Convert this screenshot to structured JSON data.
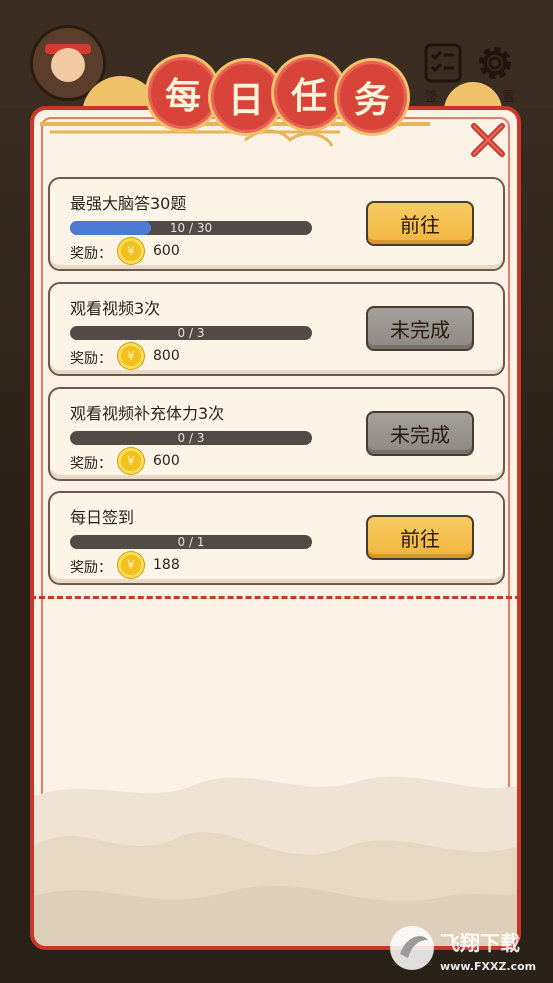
{
  "title_chars": [
    "每",
    "日",
    "任",
    "务"
  ],
  "top_right": {
    "checkin_label": "签",
    "settings_label": "置"
  },
  "tasks": [
    {
      "name": "最强大脑答30题",
      "progress_text": "10 / 30",
      "progress": 0.3333,
      "reward_label": "奖励：",
      "coin_symbol": "¥",
      "reward": "600",
      "button": "前往",
      "state": "go"
    },
    {
      "name": "观看视频3次",
      "progress_text": "0 / 3",
      "progress": 0,
      "reward_label": "奖励：",
      "coin_symbol": "¥",
      "reward": "800",
      "button": "未完成",
      "state": "pending"
    },
    {
      "name": "观看视频补充体力3次",
      "progress_text": "0 / 3",
      "progress": 0,
      "reward_label": "奖励：",
      "coin_symbol": "¥",
      "reward": "600",
      "button": "未完成",
      "state": "pending"
    },
    {
      "name": "每日签到",
      "progress_text": "0 / 1",
      "progress": 0,
      "reward_label": "奖励：",
      "coin_symbol": "¥",
      "reward": "188",
      "button": "前往",
      "state": "go"
    }
  ],
  "watermark": {
    "brand": "飞翔下载",
    "url": "www.FXXZ.com"
  },
  "colors": {
    "panel_border": "#c9362a",
    "go_button": "#f1b43d",
    "pending_button": "#8d8884",
    "progress_fill": "#4b7bd2"
  },
  "icons": {
    "close": "close-icon",
    "checkin": "checklist-icon",
    "settings": "gear-icon",
    "coin": "coin-icon"
  }
}
